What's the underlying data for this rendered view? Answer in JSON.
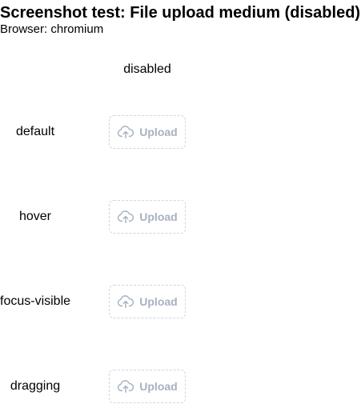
{
  "page": {
    "title": "Screenshot test: File upload medium (disabled)",
    "browser_line": "Browser: chromium"
  },
  "grid": {
    "column_header": "disabled",
    "rows": [
      {
        "state": "default",
        "button_label": "Upload",
        "icon": "cloud-upload-icon"
      },
      {
        "state": "hover",
        "button_label": "Upload",
        "icon": "cloud-upload-icon"
      },
      {
        "state": "focus-visible",
        "button_label": "Upload",
        "icon": "cloud-upload-icon"
      },
      {
        "state": "dragging",
        "button_label": "Upload",
        "icon": "cloud-upload-icon"
      }
    ]
  },
  "colors": {
    "disabled_text": "#a7b1bf",
    "disabled_border": "#cfd6df"
  }
}
